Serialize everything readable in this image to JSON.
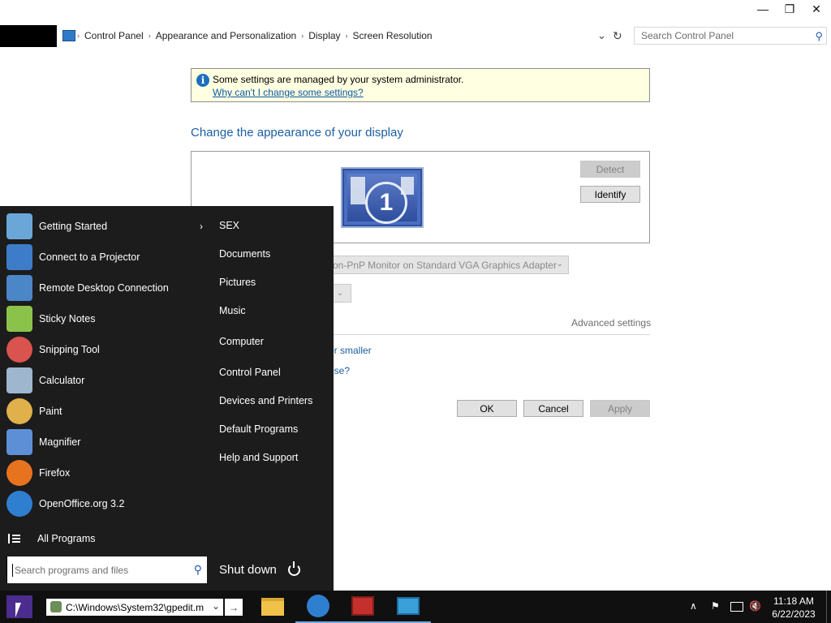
{
  "window": {
    "minimize_glyph": "—",
    "restore_glyph": "❐",
    "close_glyph": "✕"
  },
  "address": {
    "crumbs": [
      "Control Panel",
      "Appearance and Personalization",
      "Display",
      "Screen Resolution"
    ],
    "dropdown_glyph": "⌄",
    "refresh_glyph": "↻"
  },
  "search": {
    "placeholder": "Search Control Panel"
  },
  "infobar": {
    "icon": "i",
    "message": "Some settings are managed by your system administrator.",
    "link": "Why can't I change some settings?"
  },
  "main": {
    "title": "Change the appearance of your display",
    "monitor_number": "1",
    "detect_label": "Detect",
    "identify_label": "Identify",
    "display_value": "on-PnP Monitor on Standard VGA Graphics Adapter",
    "advanced_settings": "Advanced settings",
    "link_text_size": "or smaller",
    "link_choose": "ose?",
    "ok_label": "OK",
    "cancel_label": "Cancel",
    "apply_label": "Apply"
  },
  "startmenu": {
    "programs": [
      {
        "label": "Getting Started",
        "icon": "getting-started-icon",
        "color": "#6aa7d8"
      },
      {
        "label": "Connect to a Projector",
        "icon": "projector-icon",
        "color": "#3d7cc9"
      },
      {
        "label": "Remote Desktop Connection",
        "icon": "remote-desktop-icon",
        "color": "#4a86c8"
      },
      {
        "label": "Sticky Notes",
        "icon": "sticky-notes-icon",
        "color": "#8bc34a"
      },
      {
        "label": "Snipping Tool",
        "icon": "snipping-tool-icon",
        "color": "#d9534f"
      },
      {
        "label": "Calculator",
        "icon": "calculator-icon",
        "color": "#9fb6cf"
      },
      {
        "label": "Paint",
        "icon": "paint-icon",
        "color": "#e0b04a"
      },
      {
        "label": "Magnifier",
        "icon": "magnifier-icon",
        "color": "#5c8fd6"
      },
      {
        "label": "Firefox",
        "icon": "firefox-icon",
        "color": "#e8731e"
      },
      {
        "label": "OpenOffice.org 3.2",
        "icon": "openoffice-icon",
        "color": "#2f7fd1"
      }
    ],
    "submenu_arrow": "›",
    "places": [
      "SEX",
      "Documents",
      "Pictures",
      "Music",
      "Computer",
      "Control Panel",
      "Devices and Printers",
      "Default Programs",
      "Help and Support"
    ],
    "all_programs": "All Programs",
    "search_placeholder": "Search programs and files",
    "search_glyph": "⚲",
    "shutdown": "Shut down"
  },
  "taskbar": {
    "run_value": "C:\\Windows\\System32\\gpedit.m",
    "run_dropdown": "⌄",
    "run_go": "→",
    "tray_up": "∧",
    "time": "11:18 AM",
    "date": "6/22/2023"
  }
}
